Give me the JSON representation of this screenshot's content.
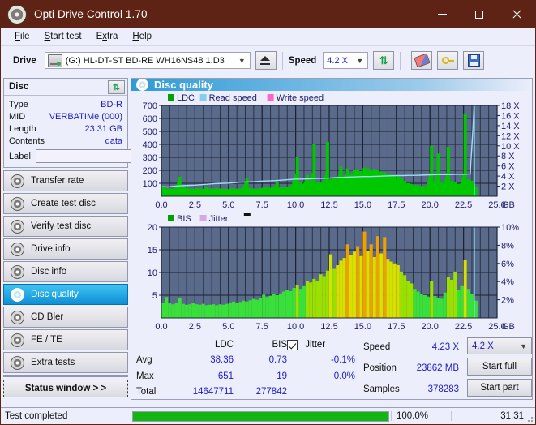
{
  "window": {
    "title": "Opti Drive Control 1.70",
    "app_icon": "disc-icon",
    "minimize": "minimize-icon",
    "maximize": "maximize-icon",
    "close": "close-icon"
  },
  "menu": [
    {
      "label": "File",
      "accel": "F"
    },
    {
      "label": "Start test",
      "accel": "S"
    },
    {
      "label": "Extra",
      "accel": "x"
    },
    {
      "label": "Help",
      "accel": "H"
    }
  ],
  "toolbar": {
    "drive_label": "Drive",
    "drive_value": "(G:)  HL-DT-ST BD-RE  WH16NS48 1.D3",
    "eject_icon": "eject-icon",
    "speed_label": "Speed",
    "speed_value": "4.2 X",
    "refresh_icon": "refresh-icon",
    "eraser_icon": "eraser-icon",
    "key_icon": "key-icon",
    "save_icon": "save-icon"
  },
  "disc": {
    "header": "Disc",
    "refresh_icon": "refresh-icon",
    "rows": [
      {
        "key": "Type",
        "value": "BD-R"
      },
      {
        "key": "MID",
        "value": "VERBATIMe (000)"
      },
      {
        "key": "Length",
        "value": "23.31 GB"
      },
      {
        "key": "Contents",
        "value": "data"
      }
    ],
    "label_key": "Label",
    "label_value": "",
    "label_placeholder": "",
    "disc_button_icon": "disc-icon"
  },
  "nav": {
    "items": [
      {
        "label": "Transfer rate",
        "active": false
      },
      {
        "label": "Create test disc",
        "active": false
      },
      {
        "label": "Verify test disc",
        "active": false
      },
      {
        "label": "Drive info",
        "active": false
      },
      {
        "label": "Disc info",
        "active": false
      },
      {
        "label": "Disc quality",
        "active": true
      },
      {
        "label": "CD Bler",
        "active": false
      },
      {
        "label": "FE / TE",
        "active": false
      },
      {
        "label": "Extra tests",
        "active": false
      }
    ],
    "status_window": "Status window > >"
  },
  "main": {
    "title": "Disc quality",
    "title_icon": "disc-icon"
  },
  "stats": {
    "col_headers": [
      "LDC",
      "BIS"
    ],
    "jitter_label": "Jitter",
    "jitter_checked": true,
    "rows": [
      {
        "label": "Avg",
        "ldc": "38.36",
        "bis": "0.73",
        "jitter": "-0.1%"
      },
      {
        "label": "Max",
        "ldc": "651",
        "bis": "19",
        "jitter": "0.0%"
      },
      {
        "label": "Total",
        "ldc": "14647711",
        "bis": "277842",
        "jitter": ""
      }
    ],
    "speed_label": "Speed",
    "speed_value": "4.23 X",
    "position_label": "Position",
    "position_value": "23862 MB",
    "samples_label": "Samples",
    "samples_value": "378283",
    "speed_select": "4.2 X",
    "start_full": "Start full",
    "start_part": "Start part"
  },
  "statusbar": {
    "text": "Test completed",
    "percent_label": "100.0%",
    "percent_value": 100,
    "time": "31:31"
  },
  "chart_data": [
    {
      "type": "area",
      "name": "top-chart",
      "title": "",
      "xlabel": "GB",
      "ylabel": "",
      "xlim": [
        0,
        25
      ],
      "ylim": [
        0,
        700
      ],
      "y2lim": [
        0,
        18
      ],
      "grid": true,
      "legend_position": "top-left",
      "legend": [
        {
          "label": "LDC",
          "color": "#00a000"
        },
        {
          "label": "Read speed",
          "color": "#87ceeb"
        },
        {
          "label": "Write speed",
          "color": "#ff66cc"
        }
      ],
      "xticks": [
        "0.0",
        "2.5",
        "5.0",
        "7.5",
        "10.0",
        "12.5",
        "15.0",
        "17.5",
        "20.0",
        "22.5",
        "25.0"
      ],
      "yticks": [
        100,
        200,
        300,
        400,
        500,
        600,
        700
      ],
      "y2ticks": [
        "2 X",
        "4 X",
        "6 X",
        "8 X",
        "10 X",
        "12 X",
        "14 X",
        "16 X",
        "18 X"
      ],
      "bg_color": "#5a6a8a",
      "series": [
        {
          "name": "LDC",
          "color": "#00c800",
          "x": [
            0.0,
            0.25,
            0.5,
            0.75,
            1.0,
            1.25,
            1.5,
            1.75,
            2.0,
            2.25,
            2.5,
            2.75,
            3.0,
            3.25,
            3.5,
            3.75,
            4.0,
            4.25,
            4.5,
            4.75,
            5.0,
            5.25,
            5.5,
            5.75,
            6.0,
            6.25,
            6.5,
            6.75,
            7.0,
            7.25,
            7.5,
            7.75,
            8.0,
            8.25,
            8.5,
            8.75,
            9.0,
            9.25,
            9.5,
            9.75,
            10.0,
            10.25,
            10.5,
            10.75,
            11.0,
            11.25,
            11.5,
            11.75,
            12.0,
            12.25,
            12.5,
            12.75,
            13.0,
            13.25,
            13.5,
            13.75,
            14.0,
            14.25,
            14.5,
            14.75,
            15.0,
            15.25,
            15.5,
            15.75,
            16.0,
            16.25,
            16.5,
            16.75,
            17.0,
            17.25,
            17.5,
            17.75,
            18.0,
            18.25,
            18.5,
            18.75,
            19.0,
            19.25,
            19.5,
            19.75,
            20.0,
            20.25,
            20.5,
            20.75,
            21.0,
            21.25,
            21.5,
            21.75,
            22.0,
            22.25,
            22.5,
            22.75,
            23.0,
            23.3
          ],
          "values": [
            75,
            60,
            62,
            58,
            70,
            150,
            80,
            65,
            60,
            58,
            62,
            60,
            58,
            70,
            60,
            58,
            62,
            60,
            58,
            56,
            60,
            62,
            58,
            60,
            70,
            140,
            62,
            60,
            58,
            62,
            75,
            70,
            66,
            68,
            110,
            70,
            72,
            75,
            80,
            120,
            300,
            110,
            95,
            165,
            120,
            400,
            105,
            110,
            120,
            420,
            130,
            145,
            135,
            230,
            160,
            215,
            175,
            200,
            210,
            195,
            220,
            215,
            205,
            210,
            200,
            190,
            185,
            175,
            170,
            160,
            155,
            145,
            120,
            100,
            95,
            90,
            85,
            80,
            78,
            95,
            390,
            110,
            330,
            105,
            100,
            380,
            120,
            110,
            95,
            100,
            640,
            130,
            120,
            75
          ]
        },
        {
          "name": "Read speed",
          "color": "#9fdcf5",
          "x": [
            0.0,
            0.5,
            1.0,
            1.5,
            2.0,
            2.5,
            3.0,
            3.5,
            4.0,
            4.5,
            5.0,
            5.5,
            6.0,
            6.5,
            7.0,
            7.5,
            8.0,
            8.5,
            9.0,
            9.5,
            10.0,
            10.5,
            11.0,
            11.5,
            12.0,
            12.5,
            13.0,
            13.5,
            14.0,
            14.5,
            15.0,
            15.5,
            16.0,
            16.5,
            17.0,
            17.5,
            18.0,
            18.5,
            19.0,
            19.5,
            20.0,
            20.5,
            21.0,
            21.5,
            22.0,
            22.5,
            23.0,
            23.3
          ],
          "values_x_speed": [
            1.9,
            1.85,
            2.0,
            2.1,
            2.15,
            2.2,
            2.3,
            2.4,
            2.5,
            2.55,
            2.6,
            2.7,
            2.8,
            2.85,
            2.9,
            3.0,
            3.05,
            3.1,
            3.2,
            3.3,
            3.4,
            3.4,
            3.45,
            3.5,
            3.55,
            3.6,
            3.7,
            3.75,
            3.8,
            3.85,
            3.9,
            3.9,
            3.95,
            4.0,
            4.05,
            4.1,
            4.1,
            4.15,
            4.15,
            4.2,
            4.25,
            4.3,
            4.3,
            4.3,
            4.35,
            4.35,
            4.4,
            18.0
          ]
        }
      ]
    },
    {
      "type": "area",
      "name": "bottom-chart",
      "title": "",
      "xlabel": "GB",
      "ylabel": "",
      "xlim": [
        0,
        25
      ],
      "ylim": [
        0,
        20
      ],
      "y2lim": [
        0,
        10
      ],
      "grid": true,
      "legend_position": "top-left",
      "legend": [
        {
          "label": "BIS",
          "color": "#00a000"
        },
        {
          "label": "Jitter",
          "color": "#d8a8e0"
        }
      ],
      "xticks": [
        "0.0",
        "2.5",
        "5.0",
        "7.5",
        "10.0",
        "12.5",
        "15.0",
        "17.5",
        "20.0",
        "22.5",
        "25.0"
      ],
      "yticks": [
        5,
        10,
        15,
        20
      ],
      "y2ticks": [
        "2%",
        "4%",
        "6%",
        "8%",
        "10%"
      ],
      "bg_color": "#5a6a8a",
      "series": [
        {
          "name": "BIS",
          "color": "#3ae03a",
          "x": [
            0.0,
            0.25,
            0.5,
            0.75,
            1.0,
            1.25,
            1.5,
            1.75,
            2.0,
            2.25,
            2.5,
            2.75,
            3.0,
            3.25,
            3.5,
            3.75,
            4.0,
            4.25,
            4.5,
            4.75,
            5.0,
            5.25,
            5.5,
            5.75,
            6.0,
            6.25,
            6.5,
            6.75,
            7.0,
            7.25,
            7.5,
            7.75,
            8.0,
            8.25,
            8.5,
            8.75,
            9.0,
            9.25,
            9.5,
            9.75,
            10.0,
            10.25,
            10.5,
            10.75,
            11.0,
            11.25,
            11.5,
            11.75,
            12.0,
            12.25,
            12.5,
            12.75,
            13.0,
            13.25,
            13.5,
            13.75,
            14.0,
            14.25,
            14.5,
            14.75,
            15.0,
            15.25,
            15.5,
            15.75,
            16.0,
            16.25,
            16.5,
            16.75,
            17.0,
            17.25,
            17.5,
            17.75,
            18.0,
            18.25,
            18.5,
            18.75,
            19.0,
            19.25,
            19.5,
            19.75,
            20.0,
            20.25,
            20.5,
            20.75,
            21.0,
            21.25,
            21.5,
            21.75,
            22.0,
            22.25,
            22.5,
            22.75,
            23.0,
            23.3
          ],
          "values": [
            3.3,
            4.6,
            3.2,
            3.0,
            3.4,
            4.4,
            3.1,
            2.9,
            3.0,
            3.2,
            3.0,
            2.9,
            3.1,
            2.8,
            2.9,
            3.0,
            2.8,
            3.0,
            2.9,
            3.1,
            3.4,
            3.6,
            3.3,
            3.5,
            3.8,
            3.6,
            3.9,
            4.2,
            4.0,
            4.4,
            5.1,
            4.6,
            4.9,
            5.3,
            5.0,
            5.4,
            5.8,
            6.2,
            5.9,
            6.6,
            7.2,
            6.4,
            7.0,
            8.2,
            7.8,
            8.6,
            8.2,
            9.6,
            9.2,
            10.4,
            14.0,
            10.8,
            11.6,
            12.6,
            13.2,
            16.2,
            13.8,
            14.6,
            15.8,
            13.6,
            19.0,
            14.8,
            16.2,
            13.4,
            18.0,
            14.2,
            17.8,
            13.0,
            12.4,
            12.0,
            11.6,
            10.2,
            9.4,
            8.2,
            7.6,
            6.4,
            5.8,
            5.2,
            5.0,
            4.6,
            8.2,
            4.8,
            4.4,
            4.2,
            5.6,
            9.0,
            8.4,
            10.2,
            6.2,
            7.0,
            12.8,
            6.4,
            5.2,
            3.8
          ]
        }
      ]
    }
  ]
}
